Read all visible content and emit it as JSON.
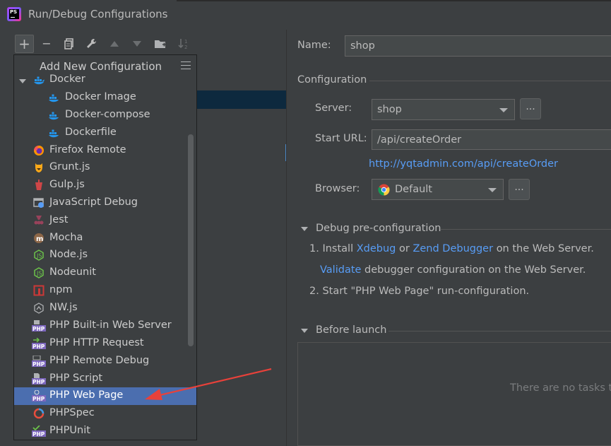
{
  "window": {
    "title": "Run/Debug Configurations"
  },
  "toolbar": {
    "add": "+",
    "remove": "−",
    "copy": "⧉",
    "edit": "🔧",
    "up": "▲",
    "down": "▼",
    "folder": "📁",
    "sort": "↓²"
  },
  "popup": {
    "title": "Add New Configuration",
    "items": [
      {
        "label": "Docker",
        "icon": "docker-icon"
      },
      {
        "label": "Docker Image",
        "icon": "docker-icon"
      },
      {
        "label": "Docker-compose",
        "icon": "docker-icon"
      },
      {
        "label": "Dockerfile",
        "icon": "docker-icon"
      },
      {
        "label": "Firefox Remote",
        "icon": "firefox-icon"
      },
      {
        "label": "Grunt.js",
        "icon": "grunt-icon"
      },
      {
        "label": "Gulp.js",
        "icon": "gulp-icon"
      },
      {
        "label": "JavaScript Debug",
        "icon": "javascript-debug-icon"
      },
      {
        "label": "Jest",
        "icon": "jest-icon"
      },
      {
        "label": "Mocha",
        "icon": "mocha-icon"
      },
      {
        "label": "Node.js",
        "icon": "nodejs-icon"
      },
      {
        "label": "Nodeunit",
        "icon": "nodeunit-icon"
      },
      {
        "label": "npm",
        "icon": "npm-icon"
      },
      {
        "label": "NW.js",
        "icon": "nwjs-icon"
      },
      {
        "label": "PHP Built-in Web Server",
        "icon": "php-icon"
      },
      {
        "label": "PHP HTTP Request",
        "icon": "php-icon"
      },
      {
        "label": "PHP Remote Debug",
        "icon": "php-icon"
      },
      {
        "label": "PHP Script",
        "icon": "php-icon"
      },
      {
        "label": "PHP Web Page",
        "icon": "php-icon"
      },
      {
        "label": "PHPSpec",
        "icon": "phpspec-icon"
      },
      {
        "label": "PHPUnit",
        "icon": "phpunit-icon"
      }
    ],
    "selected": "PHP Web Page"
  },
  "form": {
    "name_label": "Name:",
    "name_value": "shop",
    "configuration_label": "Configuration",
    "server_label": "Server:",
    "server_value": "shop",
    "server_button": "...",
    "start_url_label": "Start URL:",
    "start_url_value": "/api/createOrder",
    "full_url": "http://yqtadmin.com/api/createOrder",
    "browser_label": "Browser:",
    "browser_value": "Default",
    "browser_button": "..."
  },
  "debug": {
    "title": "Debug pre-configuration",
    "step1_prefix": "1. Install",
    "xdebug": "Xdebug",
    "or": "or",
    "zend": "Zend Debugger",
    "step1_suffix": "on the Web Server.",
    "validate": "Validate",
    "validate_suffix": "debugger configuration on the Web Server.",
    "step2": "2. Start \"PHP Web Page\" run-configuration."
  },
  "before_launch": {
    "title": "Before launch",
    "empty": "There are no tasks to"
  },
  "colors": {
    "background": "#3c3f41",
    "selection": "#4b6eaf",
    "link": "#589df6",
    "annotation_arrow": "#e8413a"
  }
}
